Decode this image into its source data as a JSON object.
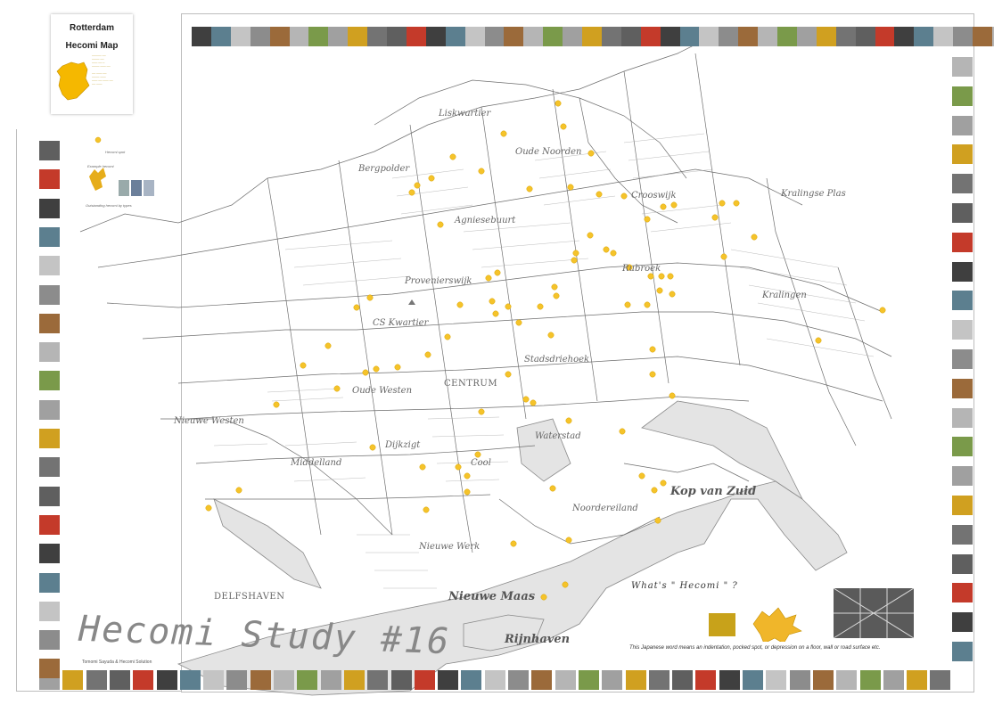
{
  "title_card": {
    "title_line1": "Rotterdam",
    "title_line2": "Hecomi Map"
  },
  "poster_title": "Hecomi Study #16",
  "credit": "Tomomi Sayuda & Hecomi Solution",
  "whats_hecomi": "What's \" Hecomi \" ?",
  "definition": "This Japanese word means an indentation, pocked spot, or depression on a floor, wall or road surface etc.",
  "legend": {
    "spot_label": "Hecomi spot",
    "samples_label": "Example hecomi",
    "footer_label": "Outstanding hecomi by types"
  },
  "district_labels": {
    "liskwartier": "Liskwartier",
    "oude_noorden": "Oude Noorden",
    "bergpolder": "Bergpolder",
    "agniesebuurt": "Agniesebuurt",
    "crooswijk": "Crooswijk",
    "kralingse_plas": "Kralingse Plas",
    "rubroek": "Rubroek",
    "provenierswijk": "Provenierswijk",
    "kralingen": "Kralingen",
    "cs_kwartier": "CS Kwartier",
    "stadsdriehoek": "Stadsdriehoek",
    "oude_westen": "Oude Westen",
    "centrum": "CENTRUM",
    "nieuwe_westen": "Nieuwe Westen",
    "dijkzigt": "Dijkzigt",
    "waterstad": "Waterstad",
    "cool": "Cool",
    "middelland": "Middelland",
    "kop_van_zuid": "Kop van Zuid",
    "noordereiland": "Noordereiland",
    "nieuwe_werk": "Nieuwe Werk",
    "delfshaven": "DELFSHAVEN",
    "nieuwe_maas": "Nieuwe Maas",
    "rijnhaven": "Rijnhaven"
  },
  "colors": {
    "spot": "#f5c32a",
    "roads": "#6e6e6e",
    "water": "#e4e4e4",
    "frame": "#bdbdbd",
    "title_blob": "#f5b800"
  },
  "spot_count": 90,
  "photo_frame": {
    "top_row_count": 43,
    "bottom_row_count": 39,
    "left_col_count": 19,
    "right_col_count": 21
  }
}
